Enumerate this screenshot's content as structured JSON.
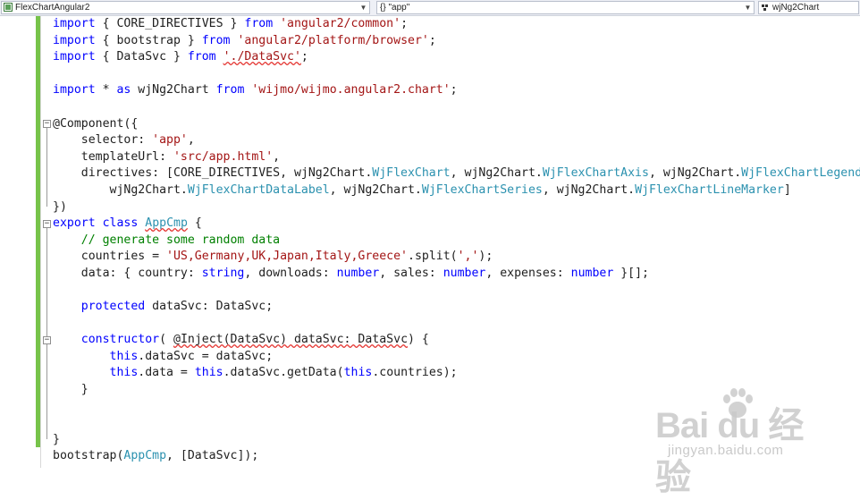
{
  "navigation": {
    "project": "FlexChartAngular2",
    "scope": "{} \"app\"",
    "member": "wjNg2Chart"
  },
  "code_lines": [
    [
      {
        "t": "import",
        "c": "kw"
      },
      {
        "t": " { CORE_DIRECTIVES } "
      },
      {
        "t": "from",
        "c": "kw"
      },
      {
        "t": " "
      },
      {
        "t": "'angular2/common'",
        "c": "str"
      },
      {
        "t": ";"
      }
    ],
    [
      {
        "t": "import",
        "c": "kw"
      },
      {
        "t": " { bootstrap } "
      },
      {
        "t": "from",
        "c": "kw"
      },
      {
        "t": " "
      },
      {
        "t": "'angular2/platform/browser'",
        "c": "str"
      },
      {
        "t": ";"
      }
    ],
    [
      {
        "t": "import",
        "c": "kw"
      },
      {
        "t": " { DataSvc } "
      },
      {
        "t": "from",
        "c": "kw"
      },
      {
        "t": " "
      },
      {
        "t": "'./DataSvc'",
        "c": "str err"
      },
      {
        "t": ";"
      }
    ],
    [],
    [
      {
        "t": "import",
        "c": "kw"
      },
      {
        "t": " * "
      },
      {
        "t": "as",
        "c": "kw"
      },
      {
        "t": " wjNg2Chart "
      },
      {
        "t": "from",
        "c": "kw"
      },
      {
        "t": " "
      },
      {
        "t": "'wijmo/wijmo.angular2.chart'",
        "c": "str"
      },
      {
        "t": ";"
      }
    ],
    [],
    [
      {
        "t": "@Component({"
      }
    ],
    [
      {
        "t": "    selector: "
      },
      {
        "t": "'app'",
        "c": "str"
      },
      {
        "t": ","
      }
    ],
    [
      {
        "t": "    templateUrl: "
      },
      {
        "t": "'src/app.html'",
        "c": "str"
      },
      {
        "t": ","
      }
    ],
    [
      {
        "t": "    directives: [CORE_DIRECTIVES, wjNg2Chart."
      },
      {
        "t": "WjFlexChart",
        "c": "typ"
      },
      {
        "t": ", wjNg2Chart."
      },
      {
        "t": "WjFlexChartAxis",
        "c": "typ"
      },
      {
        "t": ", wjNg2Chart."
      },
      {
        "t": "WjFlexChartLegend",
        "c": "typ"
      },
      {
        "t": ","
      }
    ],
    [
      {
        "t": "        wjNg2Chart."
      },
      {
        "t": "WjFlexChartDataLabel",
        "c": "typ"
      },
      {
        "t": ", wjNg2Chart."
      },
      {
        "t": "WjFlexChartSeries",
        "c": "typ"
      },
      {
        "t": ", wjNg2Chart."
      },
      {
        "t": "WjFlexChartLineMarker",
        "c": "typ"
      },
      {
        "t": "]"
      }
    ],
    [
      {
        "t": "})"
      }
    ],
    [
      {
        "t": "export",
        "c": "kw"
      },
      {
        "t": " "
      },
      {
        "t": "class",
        "c": "kw"
      },
      {
        "t": " "
      },
      {
        "t": "AppCmp",
        "c": "typ err"
      },
      {
        "t": " {"
      }
    ],
    [
      {
        "t": "    "
      },
      {
        "t": "// generate some random data",
        "c": "com"
      }
    ],
    [
      {
        "t": "    countries = "
      },
      {
        "t": "'US,Germany,UK,Japan,Italy,Greece'",
        "c": "str"
      },
      {
        "t": ".split("
      },
      {
        "t": "','",
        "c": "str"
      },
      {
        "t": ");"
      }
    ],
    [
      {
        "t": "    data: { country: "
      },
      {
        "t": "string",
        "c": "kw"
      },
      {
        "t": ", downloads: "
      },
      {
        "t": "number",
        "c": "kw"
      },
      {
        "t": ", sales: "
      },
      {
        "t": "number",
        "c": "kw"
      },
      {
        "t": ", expenses: "
      },
      {
        "t": "number",
        "c": "kw"
      },
      {
        "t": " }[];"
      }
    ],
    [],
    [
      {
        "t": "    "
      },
      {
        "t": "protected",
        "c": "kw"
      },
      {
        "t": " dataSvc: DataSvc;"
      }
    ],
    [],
    [
      {
        "t": "    "
      },
      {
        "t": "constructor",
        "c": "kw"
      },
      {
        "t": "( "
      },
      {
        "t": "@Inject(DataSvc) dataSvc: DataSvc",
        "c": "err"
      },
      {
        "t": ") {"
      }
    ],
    [
      {
        "t": "        "
      },
      {
        "t": "this",
        "c": "kw"
      },
      {
        "t": ".dataSvc = dataSvc;"
      }
    ],
    [
      {
        "t": "        "
      },
      {
        "t": "this",
        "c": "kw"
      },
      {
        "t": ".data = "
      },
      {
        "t": "this",
        "c": "kw"
      },
      {
        "t": ".dataSvc.getData("
      },
      {
        "t": "this",
        "c": "kw"
      },
      {
        "t": ".countries);"
      }
    ],
    [
      {
        "t": "    }"
      }
    ],
    [],
    [],
    [
      {
        "t": "}"
      }
    ],
    [
      {
        "t": "bootstrap("
      },
      {
        "t": "AppCmp",
        "c": "typ"
      },
      {
        "t": ", [DataSvc]);"
      }
    ]
  ],
  "watermark": {
    "logo": "Bai du 经验",
    "url": "jingyan.baidu.com"
  }
}
